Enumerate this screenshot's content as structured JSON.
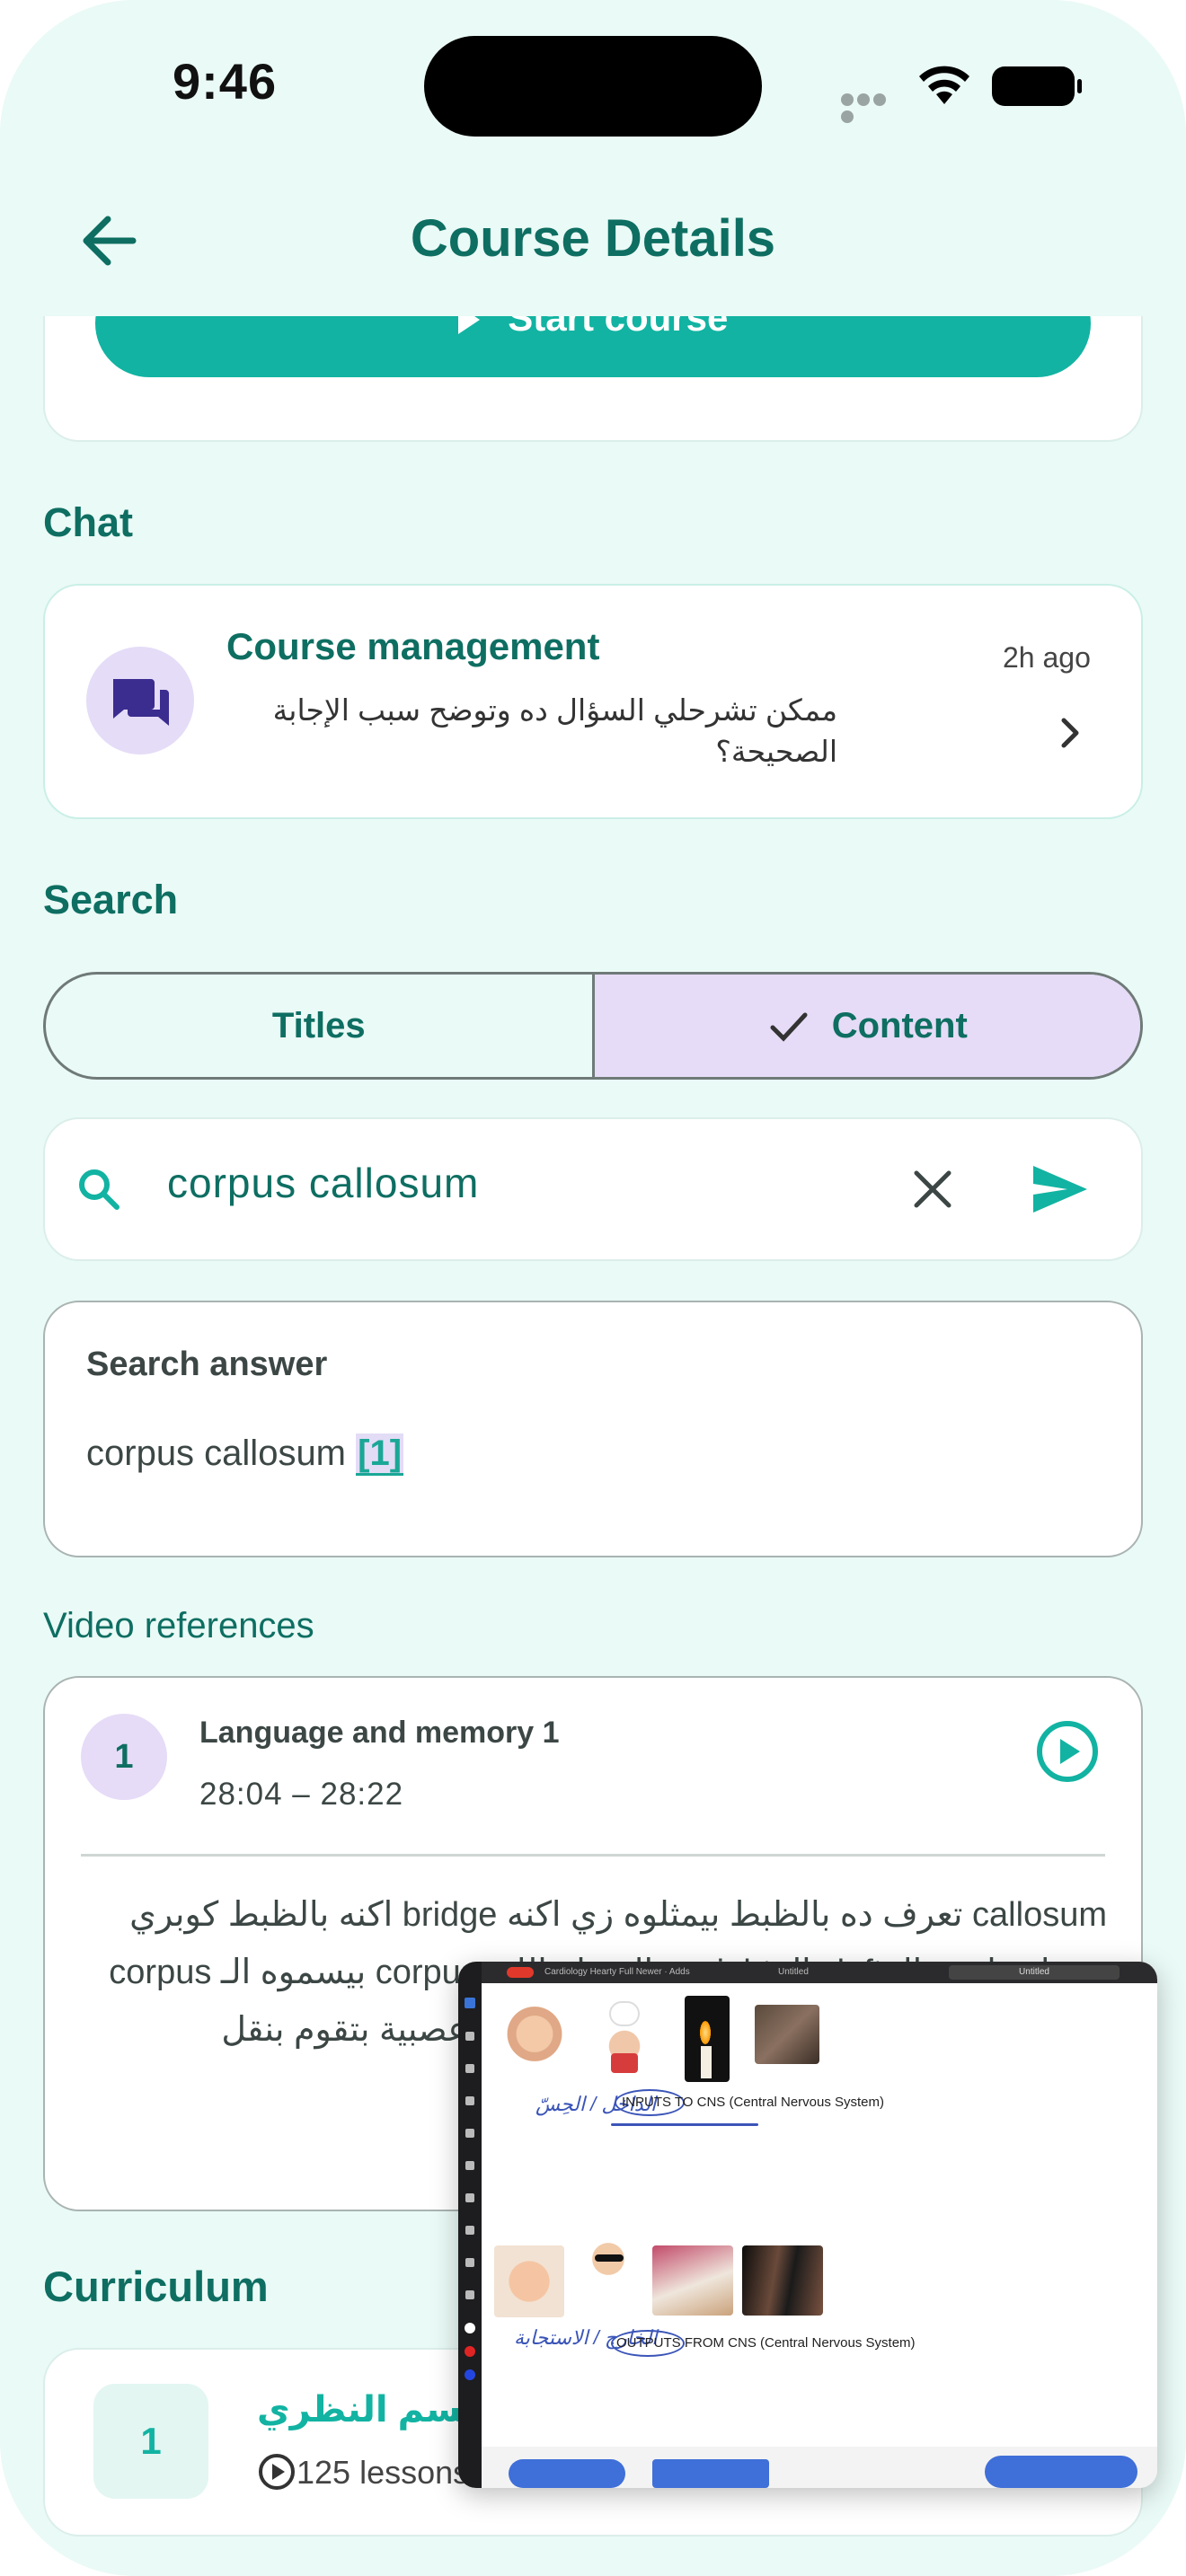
{
  "status": {
    "time": "9:46"
  },
  "header": {
    "title": "Course Details"
  },
  "start_button": {
    "label": "Start course"
  },
  "chat": {
    "section_title": "Chat",
    "name": "Course management",
    "message": "ممكن تشرحلي السؤال ده وتوضح سبب الإجابة الصحيحة؟",
    "time": "2h ago"
  },
  "search": {
    "section_title": "Search",
    "tabs": [
      {
        "label": "Titles",
        "selected": false
      },
      {
        "label": "Content",
        "selected": true
      }
    ],
    "query": "corpus callosum"
  },
  "answer": {
    "title": "Search answer",
    "text": "corpus callosum",
    "citation": "[1]"
  },
  "video_refs": {
    "section_title": "Video references",
    "items": [
      {
        "number": "1",
        "title": "Language and memory 1",
        "range": "28:04 – 28:22",
        "transcript": "callosum تعرف ده بالظبط بيمثلوه زي اكنه bridge اكنه بالظبط كوبري يوصل ما بين الـ left والـ right ده المنظر اللي corpus بيسموه الـ corpus callosum كالوزم. corpus هو عبارة عن ألياف عصبية بتقوم بنقل المعلومات ووده memory translation"
      }
    ]
  },
  "curriculum": {
    "section_title": "Curriculum",
    "items": [
      {
        "number": "1",
        "title": "القسم النظري",
        "lessons": "125 lessons"
      }
    ]
  },
  "pip": {
    "labels": {
      "inputs": "INPUTS TO CNS (Central Nervous System)",
      "outputs": "OUTPUTS FROM CNS (Central Nervous System)",
      "hand_1": "الداخل / الحِسّ",
      "hand_2": "الخارج / الاستجابة",
      "tab_1": "Cardiology Hearty Full Newer · Adds",
      "tab_2": "Untitled",
      "tab_3": "Untitled"
    }
  },
  "colors": {
    "accent": "#12b3a2",
    "primary_text": "#0e6e62",
    "selected_segment": "#e6dcf7",
    "background": "#eafaf6"
  }
}
